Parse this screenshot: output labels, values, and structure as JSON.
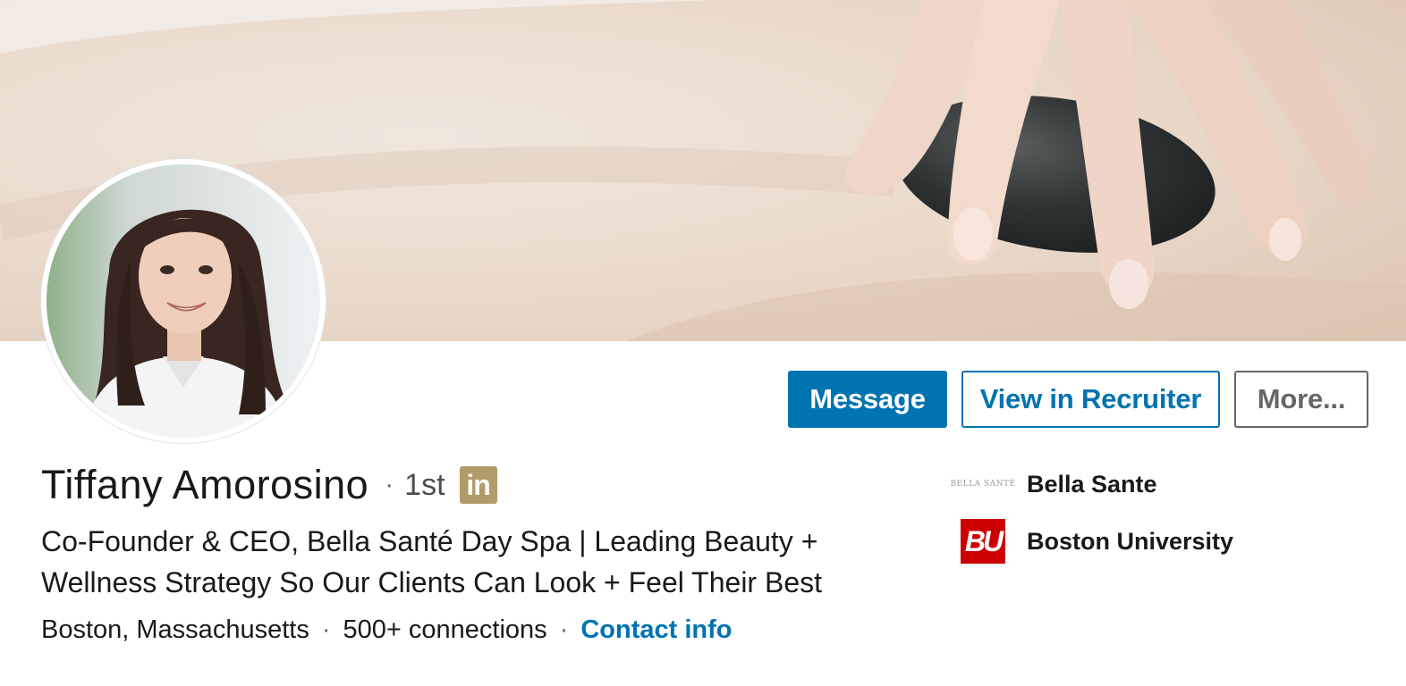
{
  "profile": {
    "name": "Tiffany Amorosino",
    "separator": "·",
    "degree": "1st",
    "badge_text": "in",
    "headline": "Co-Founder & CEO, Bella Santé Day Spa | Leading Beauty + Wellness Strategy So Our Clients Can Look + Feel Their Best",
    "location": "Boston, Massachusetts",
    "connections": "500+ connections",
    "contact_info": "Contact info"
  },
  "actions": {
    "message": "Message",
    "view_in_recruiter": "View in Recruiter",
    "more": "More..."
  },
  "organizations": [
    {
      "name": "Bella Sante",
      "logo_text": "BELLA SANTÉ",
      "icon": "bella-sante-logo"
    },
    {
      "name": "Boston University",
      "logo_text": "BU",
      "icon": "boston-university-logo"
    }
  ],
  "colors": {
    "primary": "#0073b1",
    "premium_badge": "#b09b69",
    "bu_red": "#cc0000"
  }
}
